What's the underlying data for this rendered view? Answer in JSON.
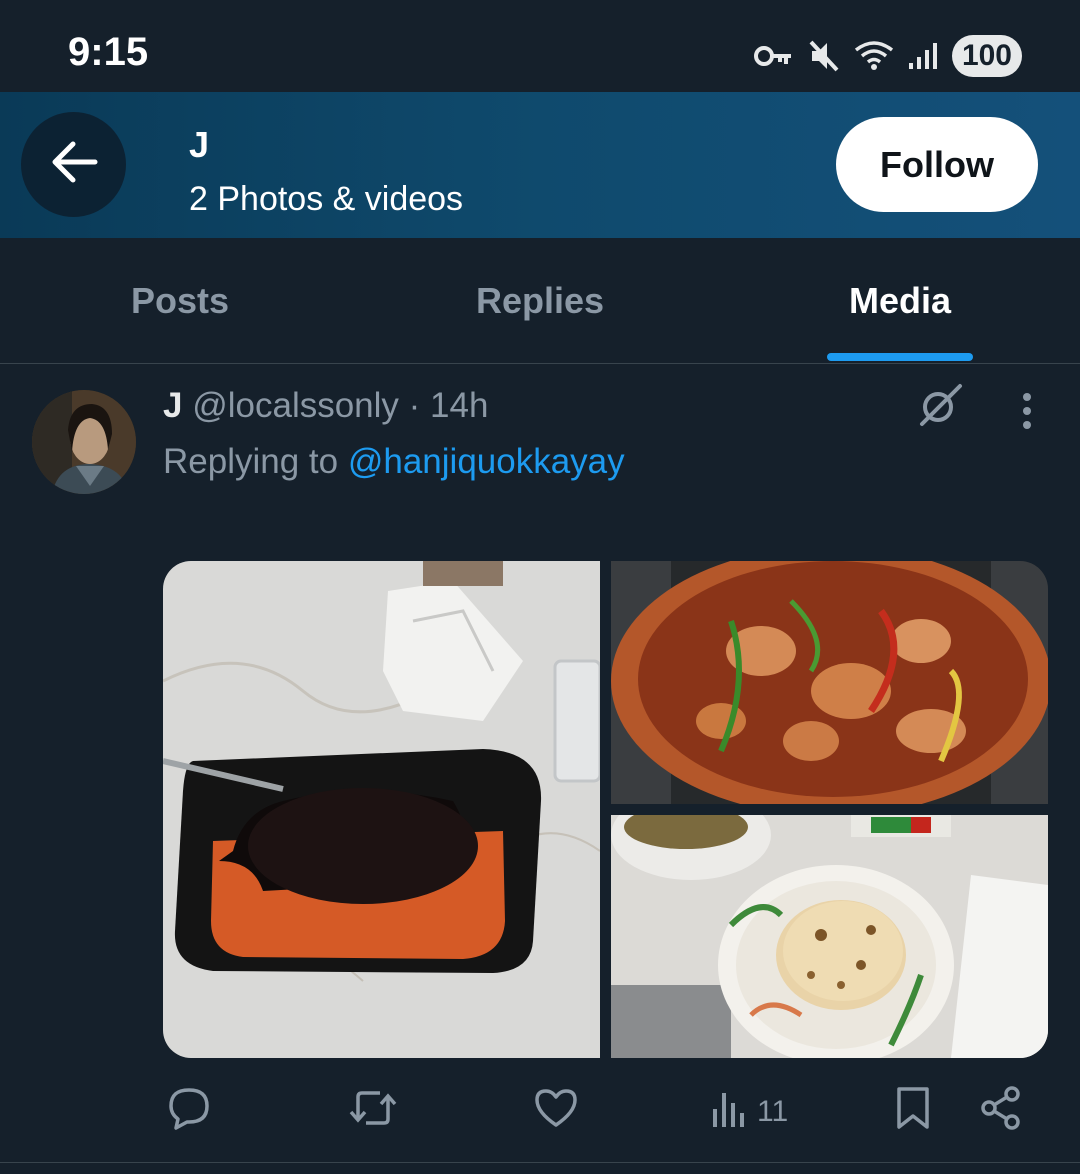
{
  "status_bar": {
    "time": "9:15",
    "battery": "100",
    "icons": [
      "vpn-key-icon",
      "mute-icon",
      "wifi-icon",
      "signal-icon",
      "battery-icon"
    ]
  },
  "header": {
    "name": "J",
    "subtitle": "2 Photos & videos",
    "follow_label": "Follow",
    "back_icon": "arrow-left-icon",
    "background_colors": [
      "#0a3a57",
      "#14507a"
    ]
  },
  "tabs": [
    {
      "label": "Posts",
      "active": false
    },
    {
      "label": "Replies",
      "active": false
    },
    {
      "label": "Media",
      "active": true
    }
  ],
  "post": {
    "display_name": "J",
    "handle": "@localssonly",
    "separator": "·",
    "time": "14h",
    "replying_prefix": "Replying to",
    "replying_to": "@hanjiquokkayay",
    "media": [
      {
        "alt": "rice-and-beans-in-container-icon"
      },
      {
        "alt": "chicken-fajitas-in-pan-icon"
      },
      {
        "alt": "tortillas-on-plate-icon"
      }
    ],
    "actions": {
      "reply_icon": "reply-icon",
      "repost_icon": "repost-icon",
      "like_icon": "heart-icon",
      "views_icon": "views-chart-icon",
      "views_count": "11",
      "bookmark_icon": "bookmark-icon",
      "share_icon": "share-icon"
    }
  },
  "colors": {
    "background": "#15202b",
    "accent": "#1d9bf0",
    "muted_text": "#8b98a5",
    "primary_text": "#e7e9ea"
  }
}
